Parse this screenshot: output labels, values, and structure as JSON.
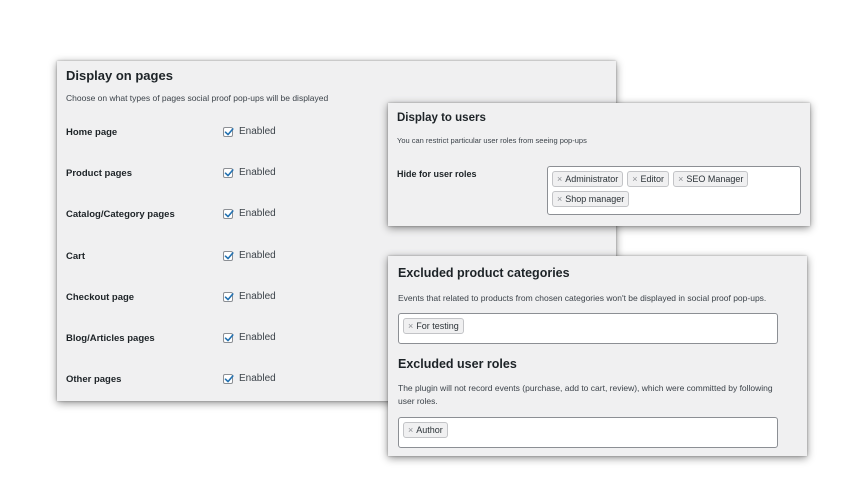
{
  "display_on_pages": {
    "title": "Display on pages",
    "description": "Choose on what types of pages social proof pop-ups will be displayed",
    "rows": [
      {
        "label": "Home page",
        "status": "Enabled",
        "checked": true
      },
      {
        "label": "Product pages",
        "status": "Enabled",
        "checked": true
      },
      {
        "label": "Catalog/Category pages",
        "status": "Enabled",
        "checked": true
      },
      {
        "label": "Cart",
        "status": "Enabled",
        "checked": true
      },
      {
        "label": "Checkout page",
        "status": "Enabled",
        "checked": true
      },
      {
        "label": "Blog/Articles pages",
        "status": "Enabled",
        "checked": true
      },
      {
        "label": "Other pages",
        "status": "Enabled",
        "checked": true
      }
    ]
  },
  "display_to_users": {
    "title": "Display to users",
    "description": "You can restrict particular user roles from seeing pop-ups",
    "field_label": "Hide for user roles",
    "tags": [
      "Administrator",
      "Editor",
      "SEO Manager",
      "Shop manager"
    ]
  },
  "excluded": {
    "categories_title": "Excluded product categories",
    "categories_description": "Events that related to products from chosen categories won't be displayed in social proof pop-ups.",
    "category_tags": [
      "For testing"
    ],
    "roles_title": "Excluded user roles",
    "roles_description": "The plugin will not record events (purchase, add to cart, review), which were committed by following user roles.",
    "role_tags": [
      "Author"
    ]
  },
  "tag_remove_symbol": "×",
  "colors": {
    "panel_bg": "#f0f0f1",
    "check_blue": "#2271b1",
    "text": "#1d2327"
  }
}
